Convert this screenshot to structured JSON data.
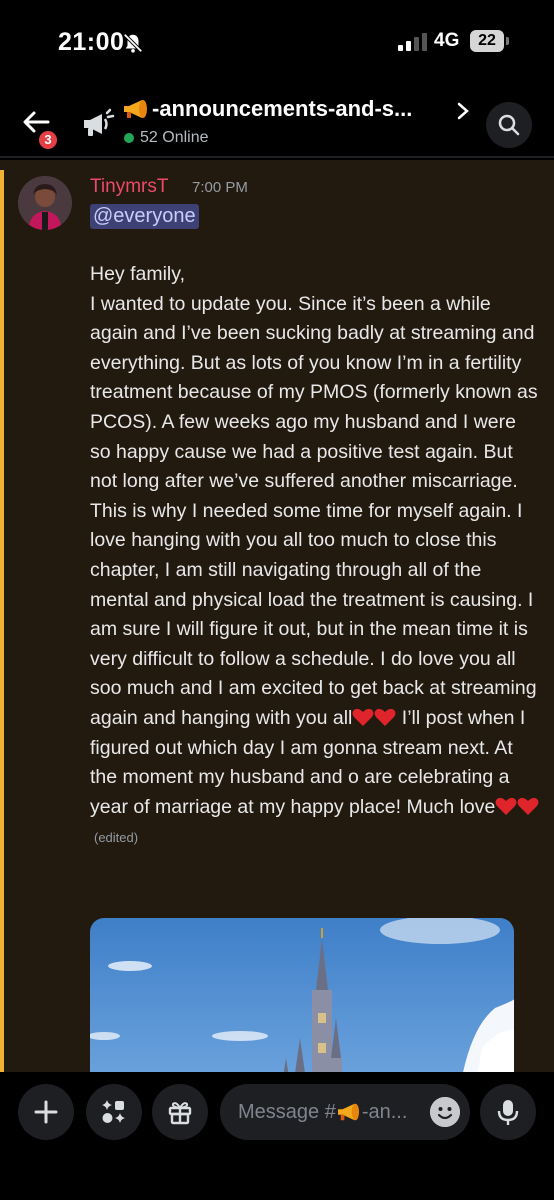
{
  "status_bar": {
    "time": "21:00",
    "network": "4G",
    "battery": "22"
  },
  "header": {
    "badge_count": "3",
    "channel_name": "-announcements-and-s...",
    "online_count": "52 Online"
  },
  "message": {
    "author": "TinymrsT",
    "timestamp": "7:00 PM",
    "mention": "@everyone",
    "greeting": "Hey family,",
    "body": "I wanted to update you. Since it’s been a while again and I’ve been sucking badly at streaming and everything. But as lots of you know I’m in a fertility treatment because of my PMOS (formerly known as PCOS). A few weeks ago my husband and I were so happy cause we had a positive test again. But not long after we’ve suffered another miscarriage. This is why I needed some time for myself again. I love hanging with you all too much to close this chapter, I am still navigating through all of the mental and physical load the treatment is causing. I am sure I will figure it out, but in the mean time it is very difficult to follow a schedule. I do love you all soo much and I am excited to get back at streaming again and hanging with you all",
    "body_after_hearts": " I’ll post when I figured out which day I am gonna stream next. At the moment my husband and o are celebrating a year of marriage at my happy place! Much love",
    "edited_label": "(edited)",
    "author_color": "#eb4a6a",
    "mention_bg": "#3e4175"
  },
  "composer": {
    "placeholder": "Message #",
    "placeholder_suffix": "-an..."
  },
  "colors": {
    "background": "#221a0e",
    "mention_bar": "#f0b232",
    "online": "#23a55a",
    "badge": "#e43f44"
  }
}
